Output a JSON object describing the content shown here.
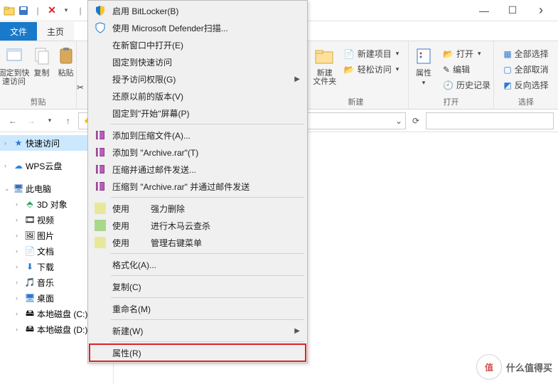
{
  "titlebar": {
    "close_x": "✕"
  },
  "tabs": {
    "file": "文件",
    "home": "主页"
  },
  "ribbon": {
    "pin": "固定到快\n速访问",
    "copy": "复制",
    "paste": "粘贴",
    "clipboard_label": "剪贴",
    "newfolder": "新建\n文件夹",
    "newitem": "新建项目",
    "easyaccess": "轻松访问",
    "new_label": "新建",
    "properties": "属性",
    "open": "打开",
    "edit": "编辑",
    "history": "历史记录",
    "open_label": "打开",
    "selectall": "全部选择",
    "selectnone": "全部取消",
    "selectinvert": "反向选择",
    "select_label": "选择"
  },
  "tree": {
    "quick": "快速访问",
    "wps": "WPS云盘",
    "pc": "此电脑",
    "obj3d": "3D 对象",
    "video": "视频",
    "pictures": "图片",
    "documents": "文档",
    "downloads": "下载",
    "music": "音乐",
    "desktop": "桌面",
    "diskc": "本地磁盘 (C:)",
    "diskd": "本地磁盘 (D:)"
  },
  "ctx": {
    "bitlocker": "启用 BitLocker(B)",
    "defender": "使用 Microsoft Defender扫描...",
    "newwindow": "在新窗口中打开(E)",
    "pinquick": "固定到快速访问",
    "grantaccess": "授予访问权限(G)",
    "restore": "还原以前的版本(V)",
    "pinstart": "固定到\"开始\"屏幕(P)",
    "addarchive": "添加到压缩文件(A)...",
    "addrar": "添加到 \"Archive.rar\"(T)",
    "zipemail": "压缩并通过邮件发送...",
    "zipraremail": "压缩到 \"Archive.rar\" 并通过邮件发送",
    "use1": "使用         强力删除",
    "use2": "使用         进行木马云查杀",
    "use3": "使用         管理右键菜单",
    "format": "格式化(A)...",
    "copy": "复制(C)",
    "rename": "重命名(M)",
    "new": "新建(W)",
    "props": "属性(R)"
  },
  "watermark": {
    "brand": "值",
    "text": "什么值得买"
  }
}
